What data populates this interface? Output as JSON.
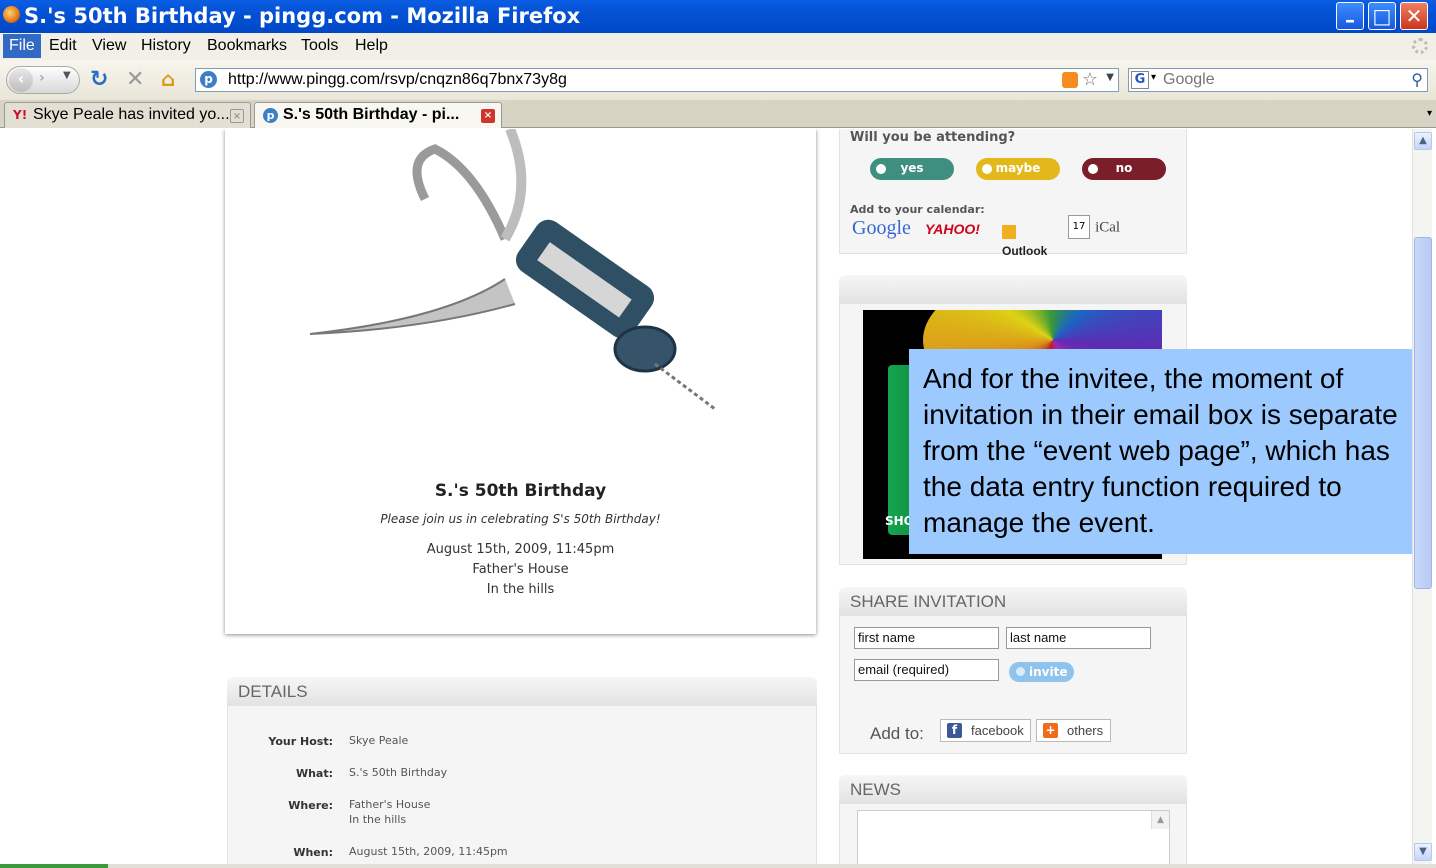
{
  "window": {
    "title": "S.'s 50th Birthday - pingg.com - Mozilla Firefox"
  },
  "menu": [
    "File",
    "Edit",
    "View",
    "History",
    "Bookmarks",
    "Tools",
    "Help"
  ],
  "address": {
    "url": "http://www.pingg.com/rsvp/cnqzn86q7bnx73y8g"
  },
  "search": {
    "placeholder": "Google"
  },
  "tabs": [
    {
      "label": "Skye Peale has invited yo...",
      "active": false
    },
    {
      "label": "S.'s 50th Birthday - pi...",
      "active": true
    }
  ],
  "event": {
    "title": "S.'s 50th Birthday",
    "subtitle": "Please join us in celebrating S's 50th Birthday!",
    "date": "August 15th, 2009, 11:45pm",
    "place": "Father's House",
    "area": "In the hills"
  },
  "details": {
    "heading": "DETAILS",
    "rows": [
      {
        "label": "Your Host:",
        "value": "Skye Peale"
      },
      {
        "label": "What:",
        "value": "S.'s 50th Birthday"
      },
      {
        "label": "Where:",
        "value": "Father's House",
        "value2": "In the hills"
      },
      {
        "label": "When:",
        "value": "August 15th, 2009, 11:45pm"
      }
    ]
  },
  "rsvp": {
    "question": "Will you be attending?",
    "yes": "yes",
    "maybe": "maybe",
    "no": "no",
    "colors": {
      "yes": "#3e8f7f",
      "maybe": "#e3b81b",
      "no": "#7a1e2a"
    },
    "calendar_label": "Add to your calendar:",
    "calendars": {
      "google": "Google",
      "yahoo": "YAHOO!",
      "outlook": "Outlook",
      "ical": "iCal",
      "ical_day": "17"
    }
  },
  "ad": {
    "text": "SHO"
  },
  "overlay_note": "And for the invitee, the moment of invitation in their email box is separate from the “event web page”, which has the data entry function required to manage the event.",
  "share": {
    "heading": "SHARE INVITATION",
    "first_name": "first name",
    "last_name": "last name",
    "email": "email (required)",
    "invite": "invite",
    "add_to": "Add to:",
    "facebook": "facebook",
    "others": "others"
  },
  "news": {
    "heading": "NEWS"
  }
}
